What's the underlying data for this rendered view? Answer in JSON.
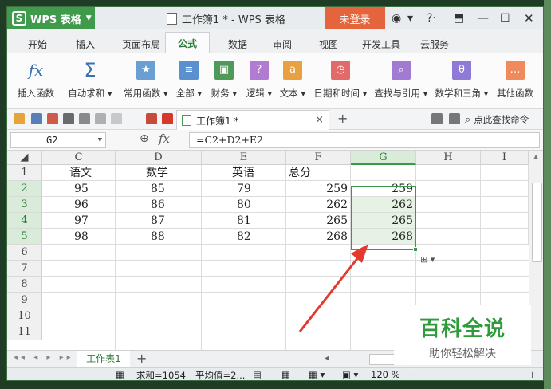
{
  "app": {
    "name": "WPS 表格",
    "logo": "S",
    "login": "未登录",
    "doc_title": "工作簿1 * - WPS 表格"
  },
  "title_icons": [
    "skin-icon",
    "shirt-icon",
    "help-icon",
    "restore-icon",
    "minimize-icon",
    "maximize-icon",
    "close-icon"
  ],
  "menu": {
    "tabs": [
      "开始",
      "插入",
      "页面布局",
      "公式",
      "数据",
      "审阅",
      "视图",
      "开发工具",
      "云服务"
    ],
    "active": "公式"
  },
  "ribbon": {
    "buttons": [
      {
        "label": "插入函数",
        "glyph": "fx"
      },
      {
        "label": "自动求和 ▾",
        "glyph": "Σ"
      },
      {
        "label": "常用函数 ▾",
        "glyph": "★",
        "color": "#6a9fd4"
      },
      {
        "label": "全部 ▾",
        "glyph": "≡",
        "color": "#5a8fd0"
      },
      {
        "label": "财务 ▾",
        "glyph": "▣",
        "color": "#4f9a58"
      },
      {
        "label": "逻辑 ▾",
        "glyph": "?",
        "color": "#b07bd1"
      },
      {
        "label": "文本 ▾",
        "glyph": "a",
        "color": "#e8a040"
      },
      {
        "label": "日期和时间 ▾",
        "glyph": "◷",
        "color": "#e26a6a"
      },
      {
        "label": "查找与引用 ▾",
        "glyph": "⌕",
        "color": "#a07bd1"
      },
      {
        "label": "数学和三角 ▾",
        "glyph": "θ",
        "color": "#8f7bd6"
      },
      {
        "label": "其他函数",
        "glyph": "…",
        "color": "#f08a5d"
      }
    ]
  },
  "toolbar": {
    "doc_tab": "工作簿1 *",
    "find_cmd": "点此查找命令",
    "add_tab": "+",
    "close_tab": "×"
  },
  "formula_bar": {
    "name_box": "G2",
    "fx": "fx",
    "formula": "=C2+D2+E2"
  },
  "grid": {
    "columns": [
      "C",
      "D",
      "E",
      "F",
      "G",
      "H",
      "I"
    ],
    "selected_column": "G",
    "rows": [
      "1",
      "2",
      "3",
      "4",
      "5",
      "6",
      "7",
      "8",
      "9",
      "10",
      "11"
    ],
    "selected_rows": [
      "2",
      "3",
      "4",
      "5"
    ],
    "header_row": [
      "语文",
      "数学",
      "英语",
      "总分"
    ],
    "data": [
      {
        "c": "95",
        "d": "85",
        "e": "79",
        "f": "259",
        "g": "259"
      },
      {
        "c": "96",
        "d": "86",
        "e": "80",
        "f": "262",
        "g": "262"
      },
      {
        "c": "97",
        "d": "87",
        "e": "81",
        "f": "265",
        "g": "265"
      },
      {
        "c": "98",
        "d": "88",
        "e": "82",
        "f": "268",
        "g": "268"
      }
    ]
  },
  "sheets": {
    "active": "工作表1",
    "add": "+"
  },
  "status": {
    "sum": "求和=1054",
    "avg": "平均值=2...",
    "zoom": "120 %",
    "zoom_minus": "−",
    "zoom_plus": "+"
  },
  "watermark": {
    "title": "百科全说",
    "subtitle": "助你轻松解决"
  },
  "colors": {
    "accent": "#3a9a49",
    "login": "#e6643b",
    "arrow": "#e23a2e"
  }
}
